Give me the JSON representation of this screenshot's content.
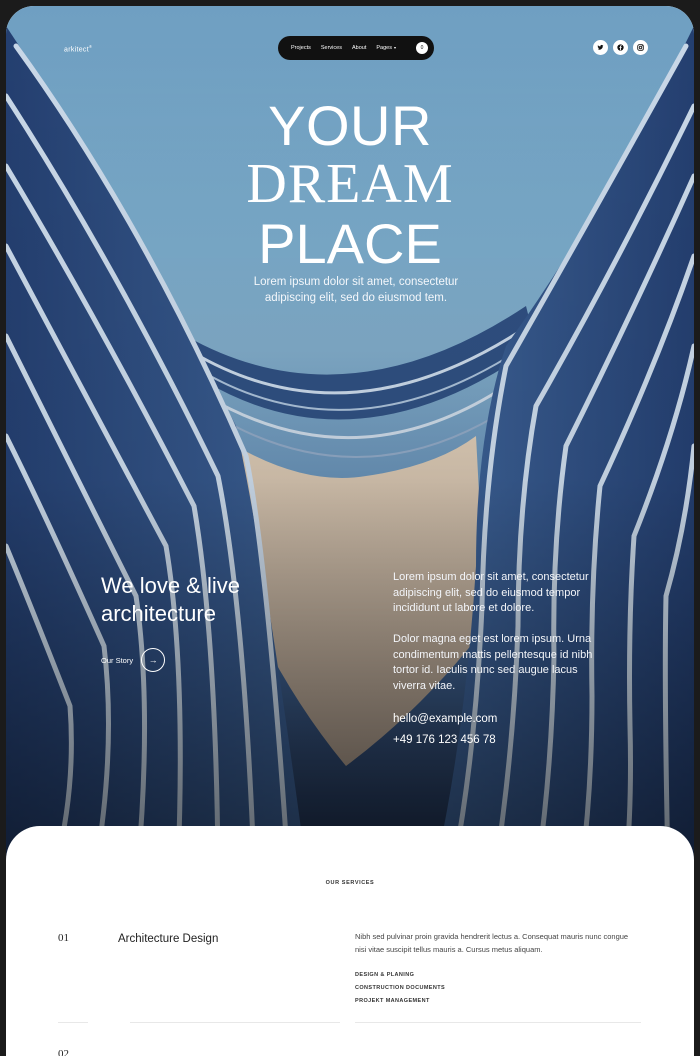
{
  "nav": {
    "logo": "arkitect",
    "logo_mark": "®",
    "items": [
      "Projects",
      "Services",
      "About",
      "Pages"
    ],
    "pages_chevron": "▾",
    "cart_count": "0",
    "social_icons": [
      "twitter-icon",
      "facebook-icon",
      "instagram-icon"
    ]
  },
  "hero": {
    "line1": "YOUR",
    "line2": "DREAM",
    "line3": "PLACE",
    "subtitle": "Lorem ipsum dolor sit amet, consectetur adipiscing elit, sed do eiusmod tem.",
    "tagline": "We love & live architecture",
    "story_label": "Our Story",
    "story_arrow": "→",
    "paragraph1": "Lorem ipsum dolor sit amet, consectetur adipiscing elit, sed do eiusmod tempor incididunt ut labore et dolore.",
    "paragraph2": "Dolor magna eget est lorem ipsum. Urna condimentum mattis pellentesque id nibh tortor id. Iaculis nunc sed augue lacus viverra vitae.",
    "email": "hello@example.com",
    "phone": "+49 176 123 456 78"
  },
  "services": {
    "heading": "OUR SERVICES",
    "items": [
      {
        "number": "01",
        "title": "Architecture Design",
        "description": "Nibh sed pulvinar proin gravida hendrerit lectus a. Consequat mauris nunc congue nisi vitae suscipit tellus mauris a. Cursus metus aliquam.",
        "tags": [
          "DESIGN & PLANING",
          "CONSTRUCTION DOCUMENTS",
          "PROJEKT MANAGEMENT"
        ]
      },
      {
        "number": "02"
      }
    ]
  },
  "colors": {
    "nav_pill": "#111111",
    "sky": "#7fa9c6",
    "building_dark": "#233d6b",
    "text_light": "#ffffff"
  }
}
